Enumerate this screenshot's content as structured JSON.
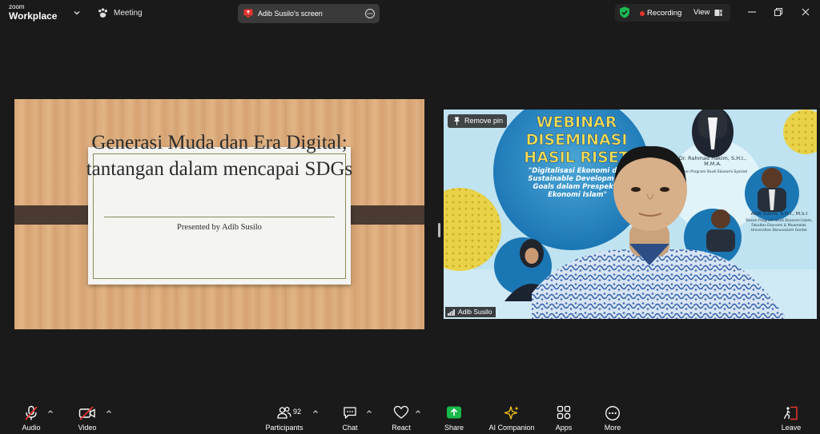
{
  "titlebar": {
    "logo_top": "zoom",
    "logo_bottom": "Workplace",
    "meeting_label": "Meeting",
    "screen_label": "Adib Susilo's screen",
    "recording_label": "Recording",
    "view_label": "View"
  },
  "slide": {
    "title": "Generasi Muda dan Era Digital; tantangan dalam mencapai SDGs",
    "presenter": "Presented by Adib Susilo"
  },
  "video": {
    "remove_pin_label": "Remove pin",
    "name": "Adib Susilo",
    "banner_line1": "WEBINAR",
    "banner_line2": "DISEMINASI",
    "banner_line3": "HASIL RISET",
    "banner_subtitle": "\"Digitalisasi Ekonomi dan Sustainable Development Goals dalam Prespektif Ekonomi Islam\"",
    "speaker1_name": "Dr. Rahmad Hakim, S.H.I., M.M.A.",
    "speaker1_role": "Dosen Program Studi Ekonomi Syariah",
    "speaker2_name": "Adib Susilo, S.H.I., M.S.I",
    "speaker2_role": "Dosen Program Studi Ekonomi Islam, Fakultas Ekonomi & Muamalat, Universitas Darussalam Gontor"
  },
  "toolbar": {
    "audio": "Audio",
    "video": "Video",
    "participants": "Participants",
    "participants_count": "92",
    "chat": "Chat",
    "react": "React",
    "share": "Share",
    "ai_companion": "AI Companion",
    "apps": "Apps",
    "more": "More",
    "leave": "Leave"
  },
  "colors": {
    "background": "#1a1a1a",
    "share_green": "#19b84a",
    "recording_red": "#e5352e",
    "shield_green": "#1db954",
    "muted_red": "#e5352e",
    "leave_red": "#e5352e"
  }
}
